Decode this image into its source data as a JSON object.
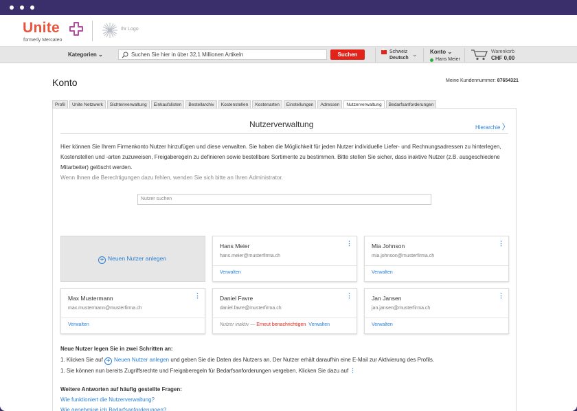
{
  "header": {
    "brand": "Unite",
    "brand_sub": "formerly Mercateo",
    "partner_logo": "Ihr Logo",
    "categories_label": "Kategorien",
    "search_placeholder": "Suchen Sie hier in über 32,1 Millionen Artikeln",
    "search_button": "Suchen",
    "country": "Schweiz",
    "language": "Deutsch",
    "account_label": "Konto",
    "account_user": "Hans Meier",
    "cart_label": "Warenkorb",
    "cart_total": "CHF 0,00"
  },
  "page": {
    "title": "Konto",
    "customer_number_label": "Meine Kundennummer:",
    "customer_number": "87654321"
  },
  "tabs": [
    {
      "label": "Profil",
      "active": false
    },
    {
      "label": "Unite Netzwerk",
      "active": false
    },
    {
      "label": "Sichtenverwaltung",
      "active": false
    },
    {
      "label": "Einkaufslisten",
      "active": false
    },
    {
      "label": "Bestellarchiv",
      "active": false
    },
    {
      "label": "Kostenstellen",
      "active": false
    },
    {
      "label": "Kostenarten",
      "active": false
    },
    {
      "label": "Einstellungen",
      "active": false
    },
    {
      "label": "Adressen",
      "active": false
    },
    {
      "label": "Nutzerverwaltung",
      "active": true
    },
    {
      "label": "Bedarfsanforderungen",
      "active": false
    }
  ],
  "main": {
    "section_title": "Nutzerverwaltung",
    "hierarchy_link": "Hierarchie",
    "intro": "Hier können Sie Ihrem Firmenkonto Nutzer hinzufügen und diese verwalten. Sie haben die Möglichkeit für jeden Nutzer individuelle Liefer- und Rechnungsadressen zu hinterlegen, Kostenstellen und -arten zuzuweisen, Freigaberegeln zu definieren sowie bestellbare Sortimente zu bestimmen. Bitte stellen Sie sicher, dass inaktive Nutzer (z.B. ausgeschiedene Mitarbeiter) gelöscht werden.",
    "intro_muted": "Wenn Ihnen die Berechtigungen dazu fehlen, wenden Sie sich bitte an Ihren Administrator.",
    "user_search_placeholder": "Nutzer suchen",
    "new_user_label": "Neuen Nutzer anlegen",
    "manage_label": "Verwalten",
    "inactive_label": "Nutzer inaktiv",
    "resend_label": "Erneut benachrichtigen",
    "users": [
      {
        "name": "Hans Meier",
        "email": "hans.meier@musterfirma.ch"
      },
      {
        "name": "Mia Johnson",
        "email": "mia.johnson@musterfirma.ch"
      },
      {
        "name": "Max Mustermann",
        "email": "max.mustermann@musterfirma.ch"
      },
      {
        "name": "Daniel Favre",
        "email": "daniel.favre@musterfirma.ch"
      },
      {
        "name": "Jan Jansen",
        "email": "jan.jansen@musterfirma.ch"
      }
    ]
  },
  "steps": {
    "heading": "Neue Nutzer legen Sie in zwei Schritten an:",
    "step1_prefix": "1. Klicken Sie auf",
    "step1_link": "Neuen Nutzer anlegen",
    "step1_suffix": "und geben Sie die Daten des Nutzers an. Der Nutzer erhält daraufhin eine E-Mail zur Aktivierung des Profils.",
    "step2": "1. Sie können nun bereits Zugriffsrechte und Freigaberegeln für Bedarfsanforderungen vergeben. Klicken Sie dazu auf"
  },
  "faq": {
    "heading": "Weitere Antworten auf häufig gestellte Fragen:",
    "q1": "Wie funktioniert die Nutzerverwaltung?",
    "q2": "Wie genehmige ich Bedarfsanforderungen?"
  },
  "colors": {
    "accent": "#2a7fd4",
    "brand": "#e8553e",
    "danger": "#e2231a",
    "frame": "#3a2f6b"
  }
}
